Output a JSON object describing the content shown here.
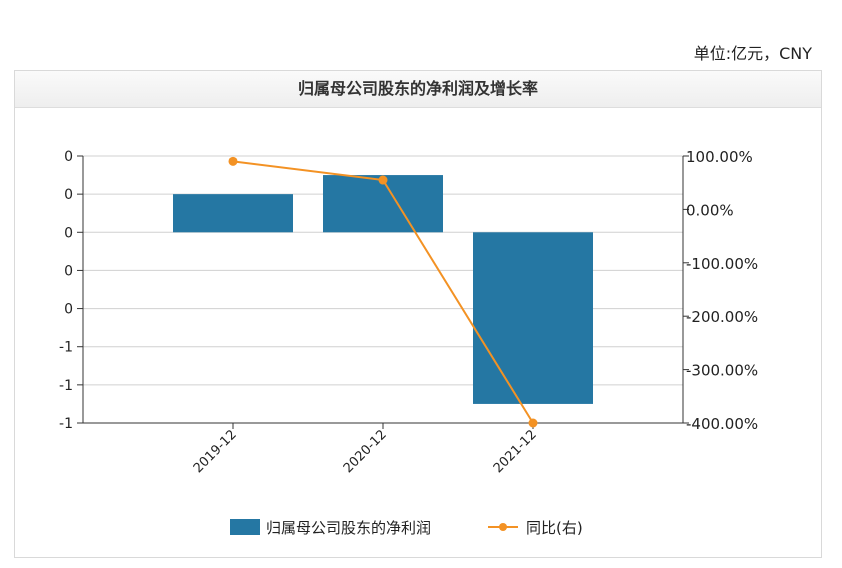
{
  "unit_label": "单位:亿元，CNY",
  "colors": {
    "bar": "#2577a3",
    "line": "#f39224",
    "grid": "#d0d0d0",
    "axis": "#333333"
  },
  "chart_data": {
    "type": "bar",
    "title": "归属母公司股东的净利润及增长率",
    "categories": [
      "2019-12",
      "2020-12",
      "2021-12"
    ],
    "series": [
      {
        "name": "归属母公司股东的净利润",
        "type": "bar",
        "axis": "left",
        "values": [
          0.1,
          0.15,
          -0.45
        ]
      },
      {
        "name": "同比(右)",
        "type": "line",
        "axis": "right",
        "values": [
          90.0,
          55.0,
          -400.0
        ]
      }
    ],
    "y_left": {
      "ylim": [
        -0.5,
        0.2
      ],
      "tick_values": [
        0.2,
        0.1,
        0.0,
        -0.1,
        -0.2,
        -0.3,
        -0.4,
        -0.5
      ],
      "tick_labels": [
        "0",
        "0",
        "0",
        "0",
        "0",
        "-1",
        "-1",
        "-1"
      ]
    },
    "y_right": {
      "ylim": [
        -400,
        100
      ],
      "tick_values": [
        100,
        0,
        -100,
        -200,
        -300,
        -400
      ],
      "tick_labels": [
        "100.00%",
        "0.00%",
        "-100.00%",
        "-200.00%",
        "-300.00%",
        "-400.00%"
      ]
    },
    "grid": true,
    "legend_position": "bottom"
  }
}
